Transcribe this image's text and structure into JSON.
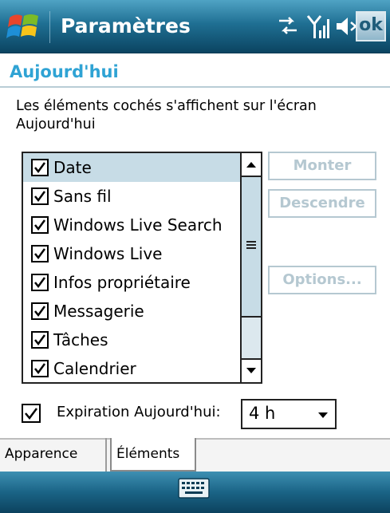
{
  "titlebar": {
    "title": "Paramètres",
    "ok_label": "ok",
    "icons": [
      "windows-start-icon",
      "connectivity-icon",
      "signal-icon",
      "volume-icon"
    ]
  },
  "page": {
    "heading": "Aujourd'hui",
    "description": "Les éléments cochés s'affichent sur l'écran Aujourd'hui"
  },
  "list": {
    "items": [
      {
        "label": "Date",
        "checked": true,
        "selected": true
      },
      {
        "label": "Sans fil",
        "checked": true,
        "selected": false
      },
      {
        "label": "Windows Live Search",
        "checked": true,
        "selected": false
      },
      {
        "label": "Windows Live",
        "checked": true,
        "selected": false
      },
      {
        "label": "Infos propriétaire",
        "checked": true,
        "selected": false
      },
      {
        "label": "Messagerie",
        "checked": true,
        "selected": false
      },
      {
        "label": "Tâches",
        "checked": true,
        "selected": false
      },
      {
        "label": "Calendrier",
        "checked": true,
        "selected": false
      }
    ]
  },
  "buttons": {
    "up": "Monter",
    "down": "Descendre",
    "options": "Options..."
  },
  "expiration": {
    "checked": true,
    "label": "Expiration Aujourd'hui:",
    "value": "4 h"
  },
  "tabs": [
    {
      "label": "Apparence",
      "active": false
    },
    {
      "label": "Éléments",
      "active": true
    }
  ],
  "colors": {
    "accent": "#2fa3d4",
    "titlebar": "#1f6f93",
    "selection": "#c7dce6",
    "disabled_text": "#b5c8d1"
  }
}
